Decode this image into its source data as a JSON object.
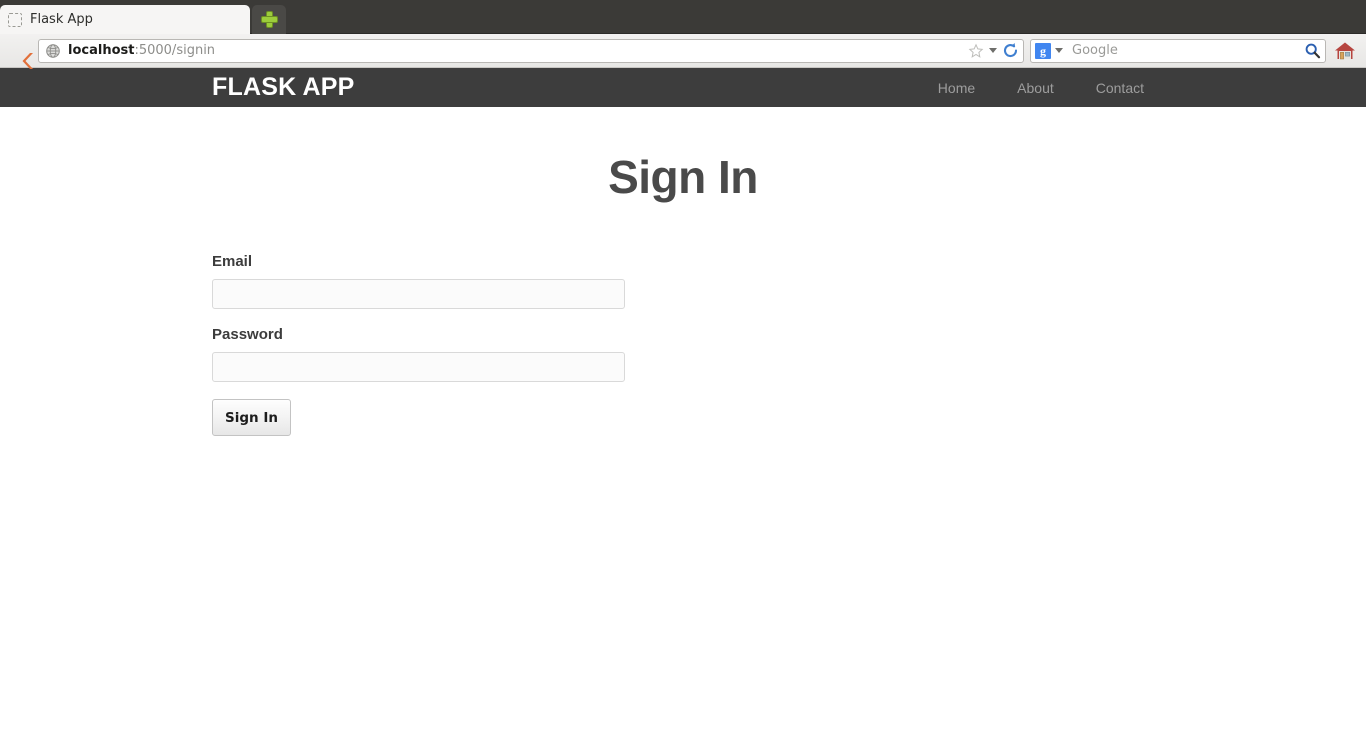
{
  "browser": {
    "tab": {
      "title": "Flask App",
      "favicon_icon": "placeholder-favicon-icon"
    },
    "new_tab_button_label": "+",
    "back_button_icon": "chevron-left-icon",
    "url_bar": {
      "identity_icon": "globe-icon",
      "host": "localhost",
      "path": ":5000/signin",
      "full_url": "localhost:5000/signin",
      "bookmark_icon": "star-icon",
      "bookmark_dropdown_icon": "chevron-down-icon",
      "reload_icon": "reload-icon"
    },
    "search_bar": {
      "engine": "Google",
      "engine_favicon_letter": "g",
      "placeholder": "Google",
      "value": "",
      "engine_dropdown_icon": "chevron-down-icon",
      "submit_icon": "magnifier-icon"
    },
    "home_button_icon": "home-icon"
  },
  "site": {
    "navbar": {
      "brand": "FLASK APP",
      "links": [
        {
          "label": "Home"
        },
        {
          "label": "About"
        },
        {
          "label": "Contact"
        }
      ]
    },
    "page": {
      "heading": "Sign In",
      "form": {
        "email": {
          "label": "Email",
          "value": "",
          "placeholder": ""
        },
        "password": {
          "label": "Password",
          "value": "",
          "placeholder": ""
        },
        "submit_label": "Sign In"
      }
    }
  },
  "colors": {
    "tab_strip_bg": "#3b3a37",
    "toolbar_bg": "#eeedeb",
    "navbar_bg": "#3d3d3d",
    "brand_text": "#ffffff",
    "nav_link_text": "#9d9d9d",
    "heading_text": "#4a4a4a",
    "input_border": "#d9d9d9",
    "input_bg": "#fbfbfb",
    "accent_plus": "#9ccc3c",
    "accent_back_arrow": "#e2703a",
    "google_blue": "#4186f0",
    "home_red": "#b6443f"
  }
}
